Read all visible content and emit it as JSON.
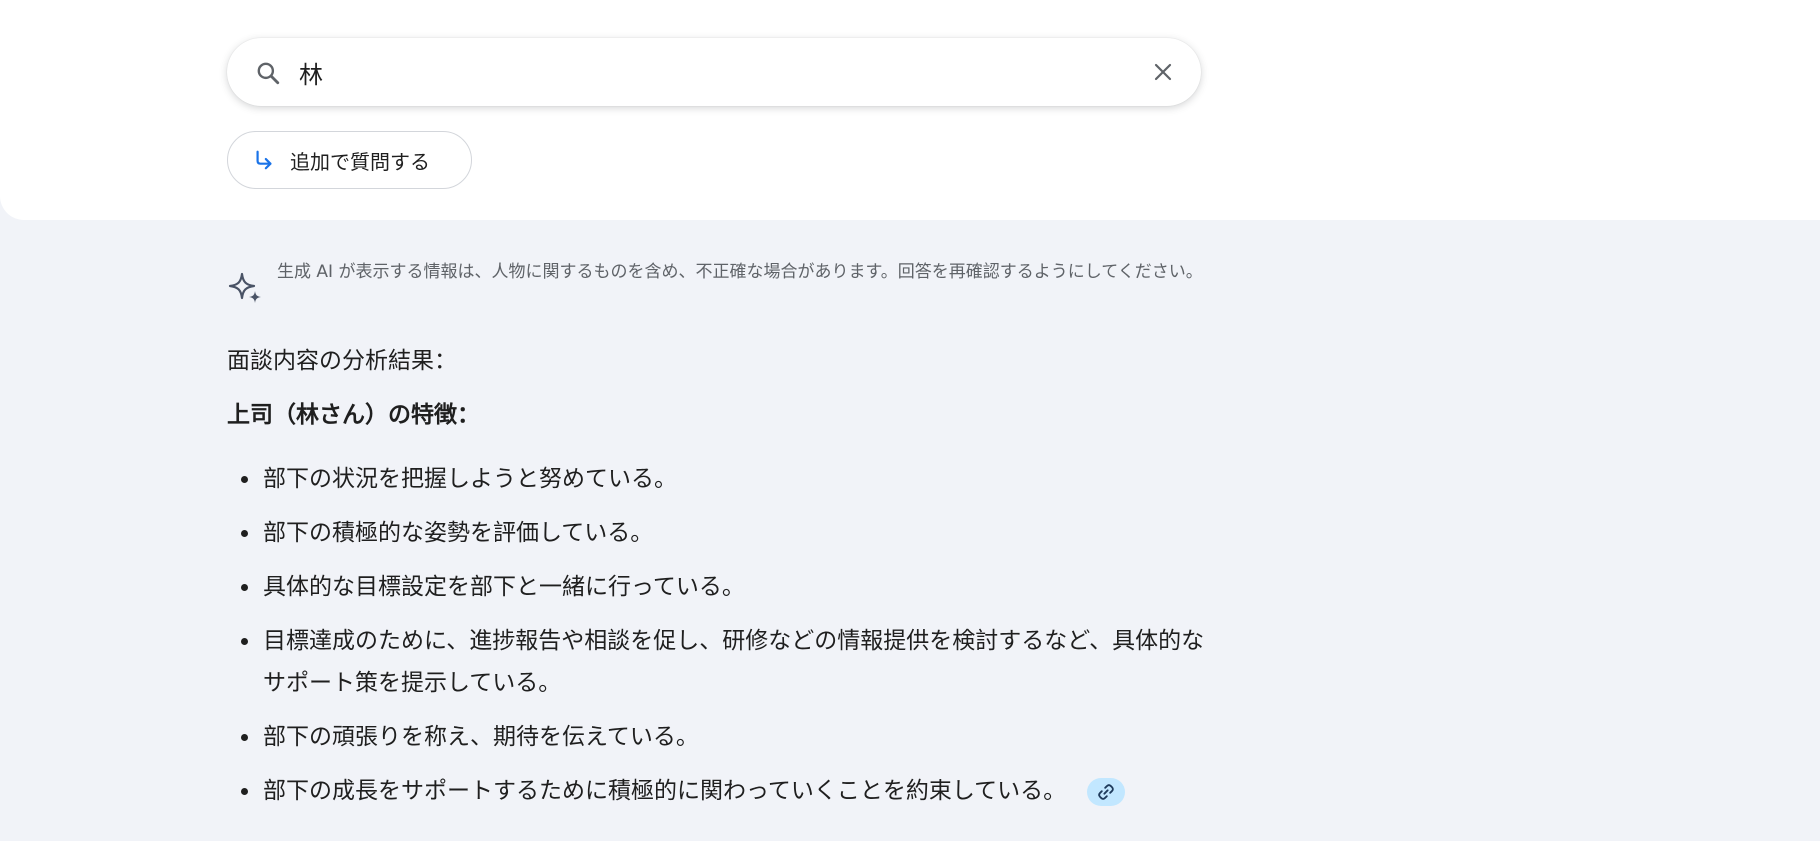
{
  "search": {
    "query": "林",
    "icon": "search-icon",
    "clear_icon": "close-icon"
  },
  "followup": {
    "label": "追加で質問する",
    "icon": "subdirectory-arrow-icon",
    "icon_color": "#1a73e8"
  },
  "disclaimer": {
    "icon": "sparkle-icon",
    "text": "生成 AI が表示する情報は、人物に関するものを含め、不正確な場合があります。回答を再確認するようにしてください。"
  },
  "content": {
    "summary_heading": "面談内容の分析結果：",
    "section_heading": "上司（林さん）の特徴：",
    "bullets": [
      "部下の状況を把握しようと努めている。",
      "部下の積極的な姿勢を評価している。",
      "具体的な目標設定を部下と一緒に行っている。",
      "目標達成のために、進捗報告や相談を促し、研修などの情報提供を検討するなど、具体的なサポート策を提示している。",
      "部下の頑張りを称え、期待を伝えている。",
      "部下の成長をサポートするために積極的に関わっていくことを約束している。"
    ],
    "link_chip_icon": "link-icon",
    "link_chip_color": "#c2e7ff"
  },
  "colors": {
    "page_background": "#f1f3f8",
    "panel_background": "#ffffff",
    "text_primary": "#1f1f1f",
    "text_secondary": "#5f6368"
  }
}
